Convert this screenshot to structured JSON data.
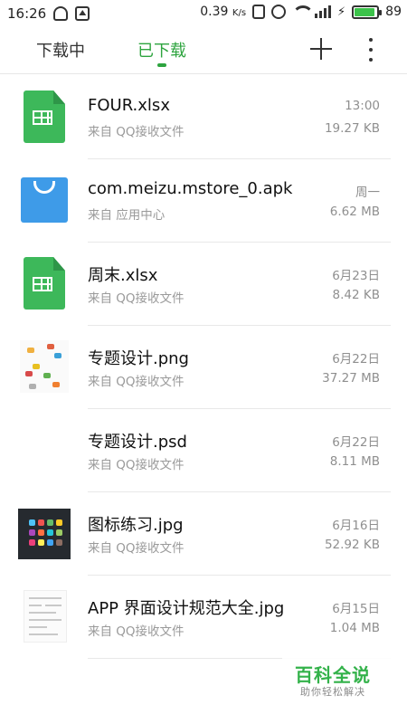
{
  "status_bar": {
    "time": "16:26",
    "speed": "0.39",
    "speed_unit": "K/s",
    "battery": "89"
  },
  "tabs": {
    "downloading": "下载中",
    "downloaded": "已下载"
  },
  "files": [
    {
      "name": "FOUR.xlsx",
      "source": "来自 QQ接收文件",
      "date": "13:00",
      "size": "19.27 KB",
      "icon": "xlsx-file-icon"
    },
    {
      "name": "com.meizu.mstore_0.apk",
      "source": "来自 应用中心",
      "date": "周一",
      "size": "6.62 MB",
      "icon": "apk-shopping-bag-icon"
    },
    {
      "name": "周末.xlsx",
      "source": "来自 QQ接收文件",
      "date": "6月23日",
      "size": "8.42 KB",
      "icon": "xlsx-file-icon"
    },
    {
      "name": "专题设计.png",
      "source": "来自 QQ接收文件",
      "date": "6月22日",
      "size": "37.27 MB",
      "icon": "png-thumbnail"
    },
    {
      "name": "专题设计.psd",
      "source": "来自 QQ接收文件",
      "date": "6月22日",
      "size": "8.11 MB",
      "icon": "psd-blank-thumbnail"
    },
    {
      "name": "图标练习.jpg",
      "source": "来自 QQ接收文件",
      "date": "6月16日",
      "size": "52.92 KB",
      "icon": "jpg-icon-grid-thumbnail"
    },
    {
      "name": "APP 界面设计规范大全.jpg",
      "source": "来自 QQ接收文件",
      "date": "6月15日",
      "size": "1.04 MB",
      "icon": "jpg-document-thumbnail"
    }
  ],
  "watermark": {
    "title": "百科全说",
    "subtitle": "助你轻松解决"
  },
  "colors": {
    "accent": "#2ea43f",
    "xlsx": "#3db85a",
    "apk": "#3e9be8"
  }
}
